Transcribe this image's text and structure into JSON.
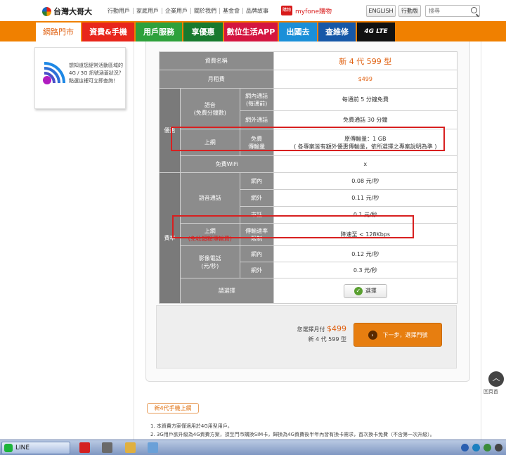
{
  "brand": {
    "name": "台灣大哥大"
  },
  "top_links": [
    "行動用戶",
    "家庭用戶",
    "企業用戶",
    "關於我們",
    "基金會",
    "品牌故事"
  ],
  "myfone": {
    "badge": "購物",
    "label": "myfone購物"
  },
  "top_buttons": {
    "english": "ENGLISH",
    "stores": "行動版"
  },
  "search": {
    "placeholder": "搜尋"
  },
  "nav": [
    {
      "label": "網路門市",
      "active": true
    },
    {
      "label": "資費&手機"
    },
    {
      "label": "用戶服務"
    },
    {
      "label": "享優惠"
    },
    {
      "label": "數位生活APP"
    },
    {
      "label": "出國去"
    },
    {
      "label": "查維修"
    },
    {
      "label": "4G LTE"
    }
  ],
  "side_card": {
    "text": "想知道您經常活動區域的 4G / 3G 訊號涵蓋狀況？點選這裡可立即查詢！"
  },
  "plan_table": {
    "header_label": "資費名稱",
    "plan_name": "新 4 代 599 型",
    "monthly_label": "月租費",
    "monthly_value": "$499",
    "group_benefit": "優惠",
    "group_rates": "費率",
    "voice_free_label": "語音\n(免費分鐘數)",
    "onnet_label": "網內通話\n(每通前)",
    "onnet_value": "每通前 5 分鐘免費",
    "offnet_label": "網外通話",
    "offnet_value": "免費通話 30 分鐘",
    "data_label": "上網",
    "data_sub_label": "免費\n傳輸量",
    "data_value_line1": "原傳輸量：1 GB",
    "data_value_line2": "( 各專案皆有額外優惠傳輸量，依所選擇之專案說明為準 )",
    "wifi_label": "免費WiFi",
    "wifi_value": "x",
    "voice_rate_label": "語音通話",
    "voice_onnet_label": "網內",
    "voice_onnet_value": "0.08 元/秒",
    "voice_offnet_label": "網外",
    "voice_offnet_value": "0.11 元/秒",
    "voice_local_label": "市話",
    "voice_local_value": "0.1 元/秒",
    "data_over_label": "上網",
    "data_over_note": "(免收超額傳輸費)",
    "speed_label": "傳輸速率\n限制",
    "speed_value": "降速至 < 128Kbps",
    "video_label": "影像電話\n(元/秒)",
    "video_onnet_label": "網內",
    "video_onnet_value": "0.12 元/秒",
    "video_offnet_label": "網外",
    "video_offnet_value": "0.3 元/秒",
    "choose_label": "請選擇",
    "select_button": "選擇"
  },
  "summary": {
    "prefix": "您選擇月付",
    "price": "$499",
    "plan": "新 4 代 599 型",
    "next_button": "下一步，選擇門號"
  },
  "notice": {
    "title": "新4代手機上網",
    "line1": "1. 本資費方案僅適用於4G用型用戶。",
    "line2": "2. 3G用戶欲升級為4G資費方案，須至門市購換SIM卡，歸換為4G資費後半年內皆有換卡需求，首次換卡免費（不含第一次升級）。"
  },
  "back_to_top": {
    "label": "回頁首"
  },
  "taskbar": {
    "line_label": "LINE"
  }
}
